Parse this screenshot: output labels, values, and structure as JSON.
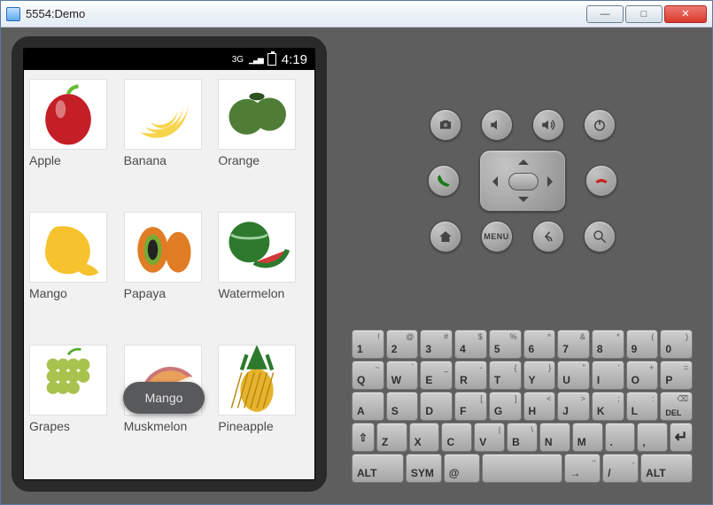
{
  "window": {
    "title": "5554:Demo"
  },
  "statusbar": {
    "net": "3G",
    "time": "4:19"
  },
  "fruits": [
    {
      "name": "Apple"
    },
    {
      "name": "Banana"
    },
    {
      "name": "Orange"
    },
    {
      "name": "Mango"
    },
    {
      "name": "Papaya"
    },
    {
      "name": "Watermelon"
    },
    {
      "name": "Grapes"
    },
    {
      "name": "Muskmelon"
    },
    {
      "name": "Pineapple"
    }
  ],
  "toast": "Mango",
  "controls": {
    "row1": [
      "camera",
      "vol-down",
      "vol-up",
      "power"
    ],
    "row2": [
      "call",
      "dpad",
      "end-call"
    ],
    "row3": [
      "home",
      "menu",
      "back",
      "search"
    ],
    "menu_label": "MENU"
  },
  "keyboard": [
    [
      {
        "m": "1",
        "s": "!"
      },
      {
        "m": "2",
        "s": "@"
      },
      {
        "m": "3",
        "s": "#"
      },
      {
        "m": "4",
        "s": "$"
      },
      {
        "m": "5",
        "s": "%"
      },
      {
        "m": "6",
        "s": "^"
      },
      {
        "m": "7",
        "s": "&"
      },
      {
        "m": "8",
        "s": "*"
      },
      {
        "m": "9",
        "s": "("
      },
      {
        "m": "0",
        "s": ")"
      }
    ],
    [
      {
        "m": "Q",
        "s": "~"
      },
      {
        "m": "W",
        "s": "`"
      },
      {
        "m": "E",
        "s": "_"
      },
      {
        "m": "R",
        "s": "-"
      },
      {
        "m": "T",
        "s": "{"
      },
      {
        "m": "Y",
        "s": "}"
      },
      {
        "m": "U",
        "s": "\""
      },
      {
        "m": "I",
        "s": "'"
      },
      {
        "m": "O",
        "s": "+"
      },
      {
        "m": "P",
        "s": "="
      }
    ],
    [
      {
        "m": "A"
      },
      {
        "m": "S"
      },
      {
        "m": "D"
      },
      {
        "m": "F",
        "s": "["
      },
      {
        "m": "G",
        "s": "]"
      },
      {
        "m": "H",
        "s": "<"
      },
      {
        "m": "J",
        "s": ">"
      },
      {
        "m": "K",
        "s": ";"
      },
      {
        "m": "L",
        "s": ":"
      },
      {
        "m": "DEL",
        "s": "",
        "icon": "del"
      }
    ],
    [
      {
        "m": "⇧",
        "icon": "shift"
      },
      {
        "m": "Z"
      },
      {
        "m": "X"
      },
      {
        "m": "C"
      },
      {
        "m": "V",
        "s": "|"
      },
      {
        "m": "B",
        "s": "\\"
      },
      {
        "m": "N"
      },
      {
        "m": "M"
      },
      {
        "m": "."
      },
      {
        "m": ","
      },
      {
        "m": "↵",
        "icon": "enter"
      }
    ],
    [
      {
        "m": "ALT",
        "wide": true
      },
      {
        "m": "SYM"
      },
      {
        "m": "@"
      },
      {
        "m": " ",
        "wide": true,
        "space": true
      },
      {
        "m": "→",
        "s": "−"
      },
      {
        "m": "/",
        "s": ","
      },
      {
        "m": "ALT",
        "wide": true
      }
    ]
  ],
  "colors": {
    "apple": "#c41e26",
    "banana": "#f7d44b",
    "orange": "#4f7d36",
    "mango": "#f6c22e",
    "papaya": "#e07c24",
    "watermelon": "#d23a3a",
    "grapes": "#a8c24e",
    "muskmelon": "#e8a05a",
    "pineapple": "#e6b32e"
  }
}
